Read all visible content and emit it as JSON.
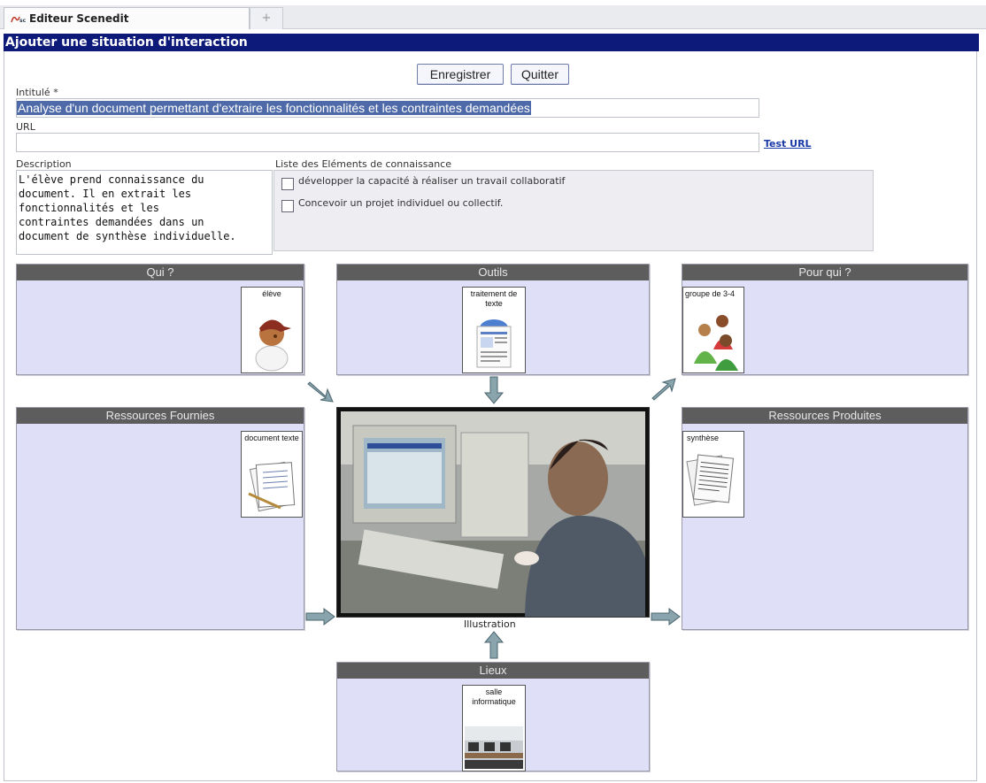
{
  "app": {
    "tab_title": "Editeur Scenedit",
    "new_tab_symbol": "+",
    "window_title": "Ajouter une situation d'interaction"
  },
  "toolbar": {
    "save_label": "Enregistrer",
    "quit_label": "Quitter"
  },
  "form": {
    "intitule_label": "Intitulé *",
    "intitule_value": "Analyse d'un document permettant d'extraire les fonctionnalités et les contraintes demandées",
    "url_label": "URL",
    "url_value": "",
    "test_url_label": "Test URL",
    "description_label": "Description",
    "description_lines": [
      "L'élève prend connaissance du",
      "document. Il en extrait les",
      "fonctionnalités et les",
      "contraintes demandées dans un",
      "document de synthèse individuelle."
    ],
    "knowledge_label": "Liste des Eléments de connaissance",
    "knowledge_items": [
      {
        "label": "développer la capacité à réaliser un travail collaboratif",
        "checked": false
      },
      {
        "label": "Concevoir un projet individuel ou collectif.",
        "checked": false
      }
    ]
  },
  "panels": {
    "qui": {
      "title": "Qui ?",
      "card_label": "élève",
      "icon": "student-icon"
    },
    "outils": {
      "title": "Outils",
      "card_label": "traitement de texte",
      "icon": "word-processor-icon"
    },
    "pour_qui": {
      "title": "Pour qui ?",
      "card_label": "groupe de 3-4",
      "icon": "group-icon"
    },
    "ressources_fournies": {
      "title": "Ressources Fournies",
      "card_label": "document texte",
      "icon": "document-pen-icon"
    },
    "ressources_produites": {
      "title": "Ressources Produites",
      "card_label": "synthèse",
      "icon": "paper-stack-icon"
    },
    "lieux": {
      "title": "Lieux",
      "card_label": "salle informatique",
      "icon": "computer-room-icon"
    }
  },
  "illustration": {
    "caption": "Illustration",
    "image": "student-at-computer-photo"
  },
  "colors": {
    "title_bar": "#0d1a7a",
    "panel_bg": "#dfdff7",
    "panel_header": "#5d5d5d",
    "selection": "#4f6aa8",
    "arrow": "#7f9aa3"
  }
}
